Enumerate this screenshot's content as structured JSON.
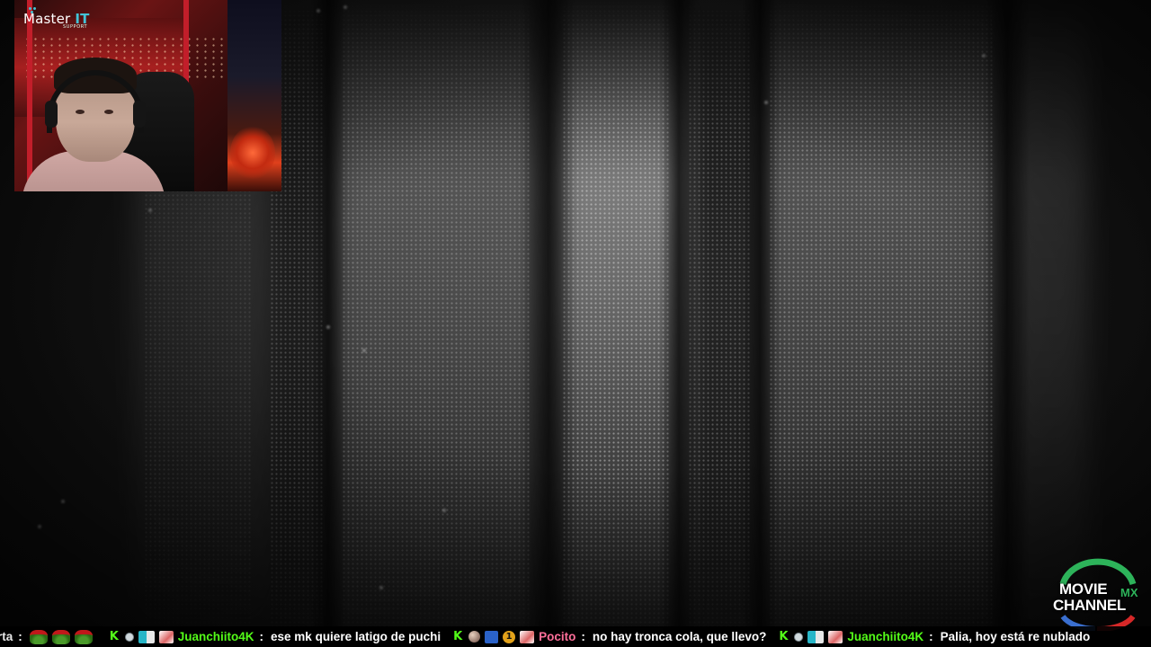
{
  "webcam": {
    "logo": {
      "brand": "Master",
      "brand_accent": "IT",
      "subtitle": "SUPPORT"
    }
  },
  "channel_logo": {
    "line1": "MOVIE",
    "line2": "CHANNEL",
    "tag": "MX"
  },
  "chat": [
    {
      "user": "rta",
      "user_color": "#e8e8e8",
      "badges": [
        "frog-icon",
        "frog-icon",
        "frog-icon"
      ],
      "text": ""
    },
    {
      "user": "Juanchiito4K",
      "user_color": "#53fc18",
      "badges": [
        "kick-icon",
        "moderator-dot-icon",
        "subscriber-icon",
        "subscriber-gift-icon"
      ],
      "text": "ese mk quiere latigo de puchi"
    },
    {
      "user": "Pocito",
      "user_color": "#ff6f9a",
      "badges": [
        "kick-icon",
        "ball-icon",
        "sword-icon",
        "gift-count-icon",
        "subscriber-gift-icon"
      ],
      "text": "no hay tronca cola, que llevo?"
    },
    {
      "user": "Juanchiito4K",
      "user_color": "#53fc18",
      "badges": [
        "kick-icon",
        "moderator-dot-icon",
        "subscriber-icon",
        "subscriber-gift-icon"
      ],
      "text": "Palia, hoy está re nublado"
    }
  ],
  "gift_count": "1",
  "colors": {
    "accent_green": "#53fc18",
    "logo_teal": "#43c3d6",
    "mx_green": "#2db35a"
  }
}
